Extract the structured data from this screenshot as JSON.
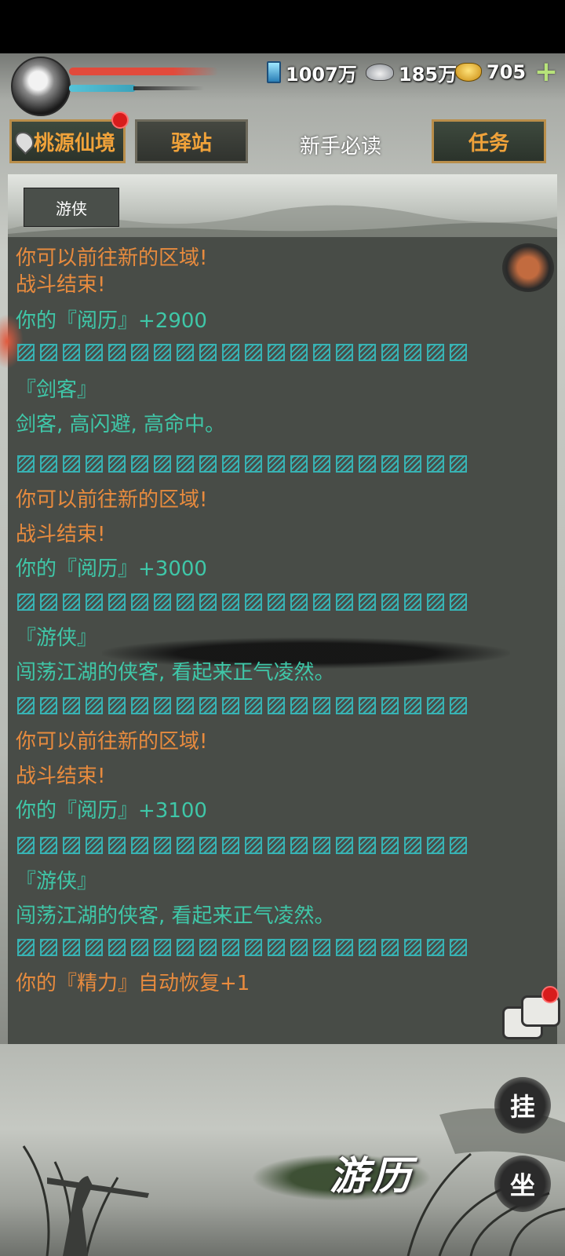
{
  "header": {
    "crystal_value": "1007万",
    "silver_value": "185万",
    "gold_value": "705",
    "icons": [
      "avatar",
      "crystal-icon",
      "silver-ingot-icon",
      "gold-ingot-icon",
      "plus-icon"
    ]
  },
  "nav": {
    "location_btn": "桃源仙境",
    "station_btn": "驿站",
    "guide_link": "新手必读",
    "quest_btn": "任务"
  },
  "region_tag": "游侠",
  "log": [
    {
      "text": "你可以前往新的区域!",
      "color": "orange"
    },
    {
      "text": "战斗结束!",
      "color": "orange"
    },
    {
      "text": "你的『阅历』+2900",
      "color": "teal"
    },
    {
      "text": "『剑客』",
      "color": "teal"
    },
    {
      "text": "剑客, 高闪避, 高命中。",
      "color": "teal"
    },
    {
      "text": "你可以前往新的区域!",
      "color": "orange"
    },
    {
      "text": "战斗结束!",
      "color": "orange"
    },
    {
      "text": "你的『阅历』+3000",
      "color": "teal"
    },
    {
      "text": "『游侠』",
      "color": "teal"
    },
    {
      "text": "闯荡江湖的侠客, 看起来正气凌然。",
      "color": "teal"
    },
    {
      "text": "你可以前往新的区域!",
      "color": "orange"
    },
    {
      "text": "战斗结束!",
      "color": "orange"
    },
    {
      "text": "你的『阅历』+3100",
      "color": "teal"
    },
    {
      "text": "『游侠』",
      "color": "teal"
    },
    {
      "text": "闯荡江湖的侠客, 看起来正气凌然。",
      "color": "teal"
    },
    {
      "text": "你的『精力』自动恢复+1",
      "color": "orange"
    }
  ],
  "actions": {
    "idle_btn": "挂",
    "sit_btn": "坐",
    "travel_btn": "游历"
  },
  "colors": {
    "orange": "#e88b3e",
    "teal": "#3fc7a8",
    "separator": "#38b2b3",
    "panel": "#484c47"
  }
}
